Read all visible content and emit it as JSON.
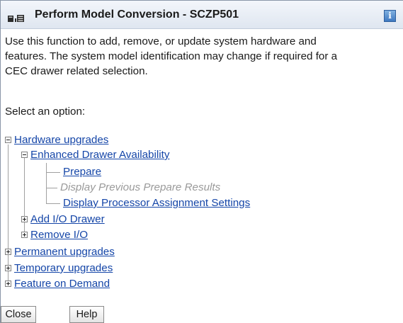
{
  "window": {
    "title": "Perform Model Conversion - SCZP501",
    "info_icon": "info-icon",
    "app_icon": "task-icon"
  },
  "description": {
    "line1": "Use this function to add, remove, or update system hardware and",
    "line2": "features. The system model identification may change if required for a",
    "line3": "CEC drawer related selection."
  },
  "prompt": "Select an option:",
  "tree": {
    "hardware_upgrades": "Hardware upgrades",
    "enhanced_drawer_availability": "Enhanced Drawer Availability",
    "prepare": "Prepare",
    "display_previous_prepare_results": "Display Previous Prepare Results",
    "display_processor_assignment_settings": "Display Processor Assignment Settings",
    "add_io_drawer": "Add I/O Drawer",
    "remove_io": "Remove I/O",
    "permanent_upgrades": "Permanent upgrades",
    "temporary_upgrades": "Temporary upgrades",
    "feature_on_demand": "Feature on Demand"
  },
  "buttons": {
    "close": "Close",
    "help": "Help"
  }
}
